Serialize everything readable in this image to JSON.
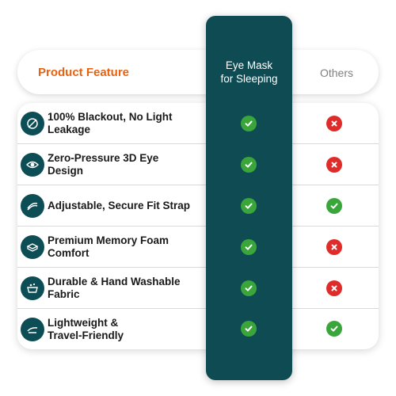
{
  "header": {
    "feature_title": "Product Feature",
    "highlight_line1": "Eye Mask",
    "highlight_line2": "for Sleeping",
    "others_title": "Others"
  },
  "colors": {
    "teal": "#0e4b53",
    "orange": "#e8620f",
    "check": "#3aa53a",
    "cross": "#e02b2b"
  },
  "rows": [
    {
      "line1": "100% Blackout, No Light",
      "line2": "Leakage",
      "icon": "no-light-icon",
      "eye_mask": "check",
      "others": "cross"
    },
    {
      "line1": "Zero-Pressure 3D Eye",
      "line2": "Design",
      "icon": "eye-icon",
      "eye_mask": "check",
      "others": "cross"
    },
    {
      "line1": "Adjustable, Secure Fit Strap",
      "line2": "",
      "icon": "strap-icon",
      "eye_mask": "check",
      "others": "check"
    },
    {
      "line1": "Premium Memory Foam",
      "line2": "Comfort",
      "icon": "foam-icon",
      "eye_mask": "check",
      "others": "cross"
    },
    {
      "line1": "Durable & Hand Washable",
      "line2": "Fabric",
      "icon": "washable-icon",
      "eye_mask": "check",
      "others": "cross"
    },
    {
      "line1": "Lightweight &",
      "line2": "Travel-Friendly",
      "icon": "lightweight-icon",
      "eye_mask": "check",
      "others": "check"
    }
  ]
}
